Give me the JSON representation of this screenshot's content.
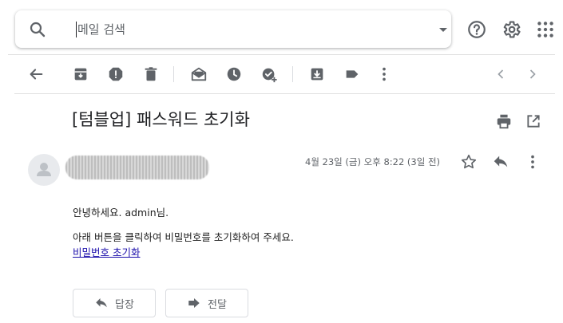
{
  "search": {
    "placeholder": "메일 검색",
    "value": ""
  },
  "email": {
    "subject": "[텀블업] 패스워드 초기화",
    "date": "4월 23일 (금) 오후 8:22 (3일 전)",
    "greeting": "안녕하세요. admin님.",
    "instruction": "아래 버튼을 클릭하여 비밀번호를 초기화하여 주세요.",
    "link_text": "비밀번호 초기화"
  },
  "actions": {
    "reply_label": "답장",
    "forward_label": "전달"
  },
  "colors": {
    "icon": "#5f6368",
    "link": "#1a0dab",
    "border": "#dadce0"
  }
}
